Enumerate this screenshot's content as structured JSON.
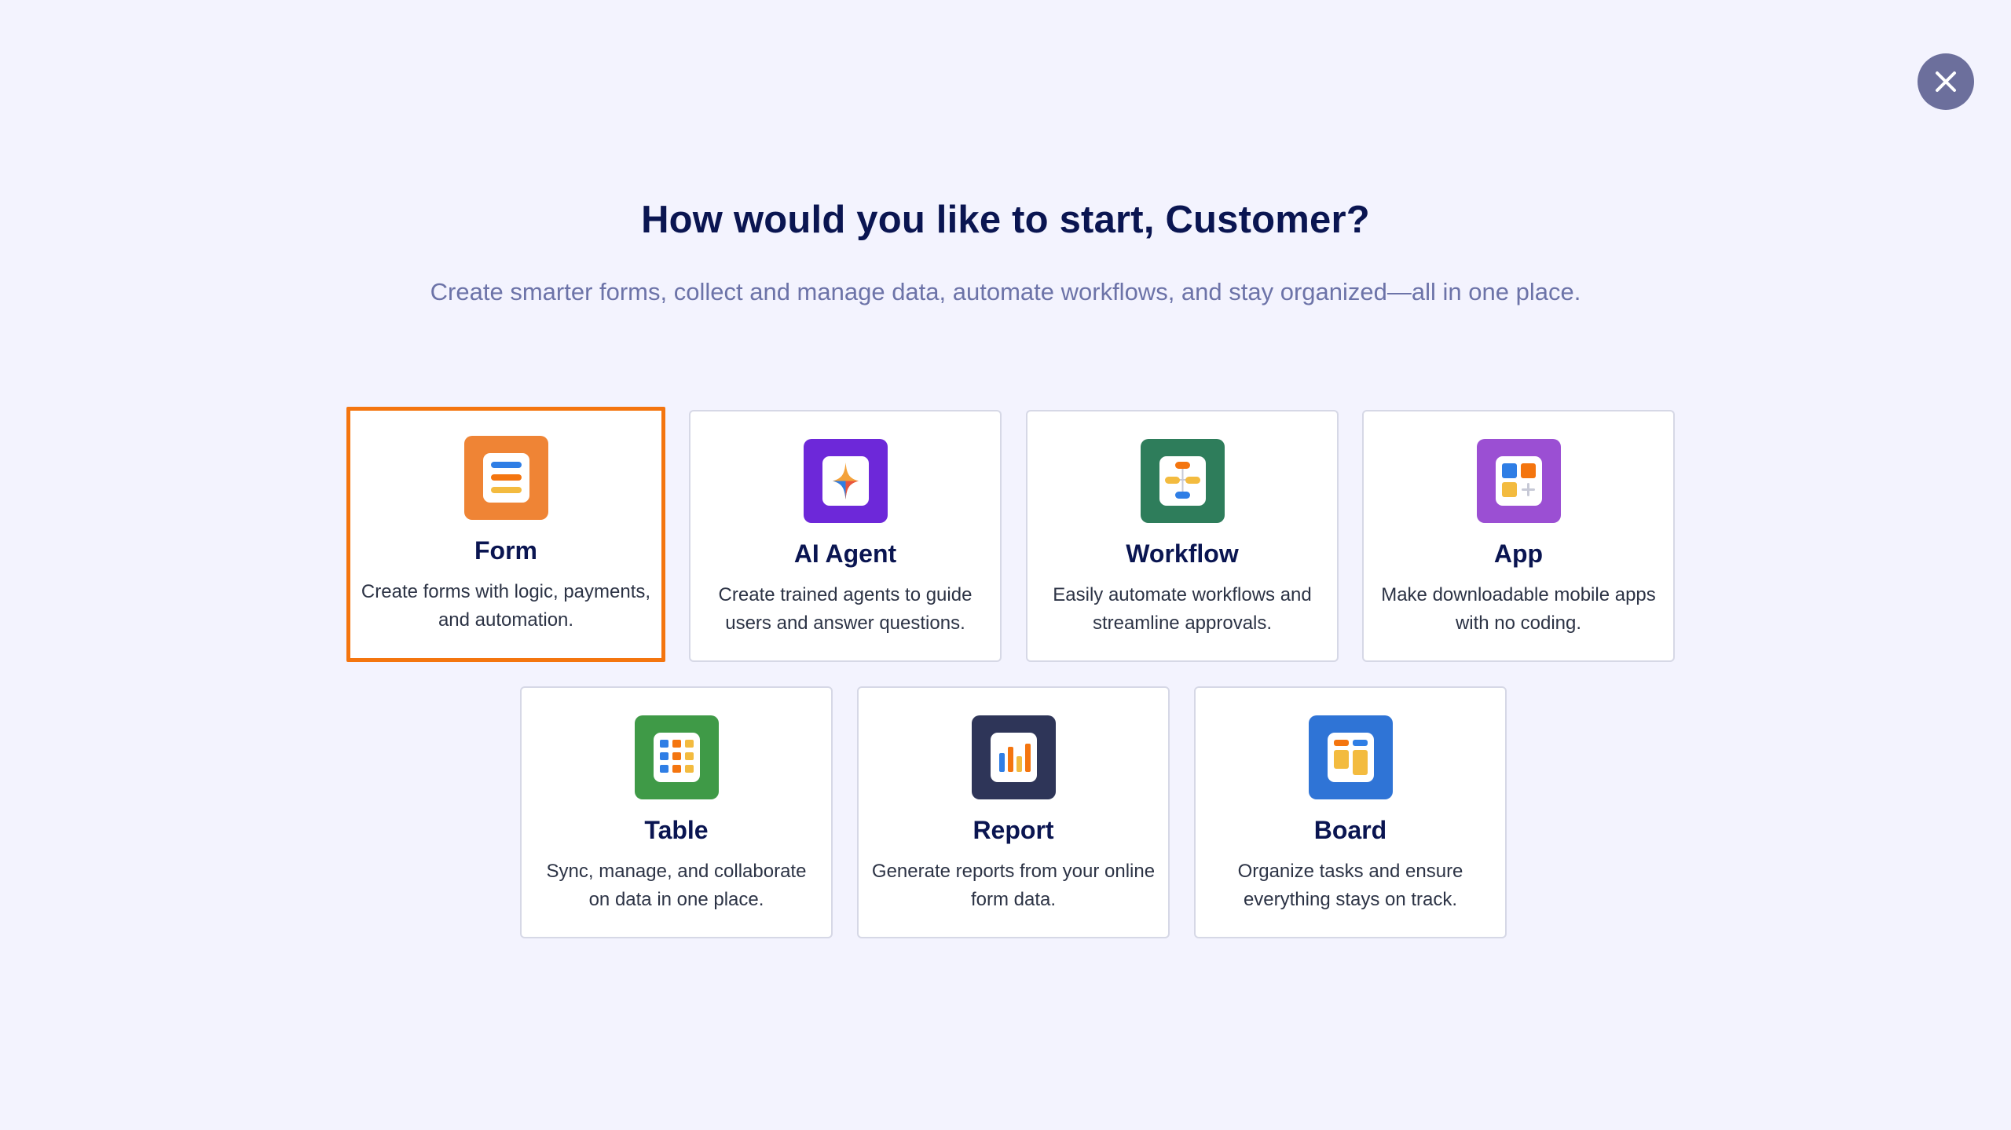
{
  "header": {
    "title": "How would you like to start, Customer?",
    "subtitle": "Create smarter forms, collect and manage data, automate workflows, and stay organized—all in one place."
  },
  "close": {
    "icon": "close-icon"
  },
  "options": [
    {
      "id": "form",
      "title": "Form",
      "description": "Create forms with logic, payments, and automation.",
      "icon": "form-icon",
      "color": "#ef8435",
      "selected": true
    },
    {
      "id": "ai-agent",
      "title": "AI Agent",
      "description": "Create trained agents to guide users and answer questions.",
      "icon": "ai-agent-icon",
      "color": "#6d28d9"
    },
    {
      "id": "workflow",
      "title": "Workflow",
      "description": "Easily automate workflows and streamline approvals.",
      "icon": "workflow-icon",
      "color": "#2e7d5b"
    },
    {
      "id": "app",
      "title": "App",
      "description": "Make downloadable mobile apps with no coding.",
      "icon": "app-icon",
      "color": "#9b4fd3"
    },
    {
      "id": "table",
      "title": "Table",
      "description": "Sync, manage, and collaborate on data in one place.",
      "icon": "table-icon",
      "color": "#3f9a47"
    },
    {
      "id": "report",
      "title": "Report",
      "description": "Generate reports from your online form data.",
      "icon": "report-icon",
      "color": "#2e3558"
    },
    {
      "id": "board",
      "title": "Board",
      "description": "Organize tasks and ensure everything stays on track.",
      "icon": "board-icon",
      "color": "#2f74d6"
    }
  ],
  "colors": {
    "background": "#f3f3fe",
    "heading": "#0a1551",
    "subtitle": "#6c73a8",
    "selection_border": "#f4750f",
    "close_button": "#6c6f9c"
  }
}
